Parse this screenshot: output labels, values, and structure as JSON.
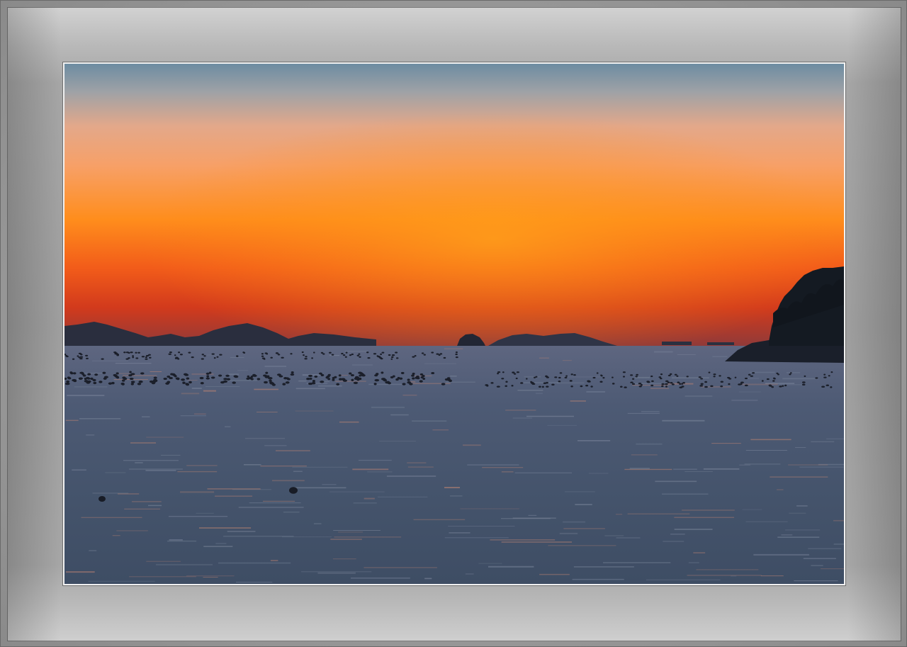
{
  "scene": {
    "subject": "sunset-over-sea",
    "colors": {
      "sky_top": "#6f8ea3",
      "sky_mid": "#f3a47a",
      "sky_glow": "#ff8a14",
      "horizon": "#e6401a",
      "sea": "#4a5870",
      "silhouette": "#1c2230"
    }
  }
}
